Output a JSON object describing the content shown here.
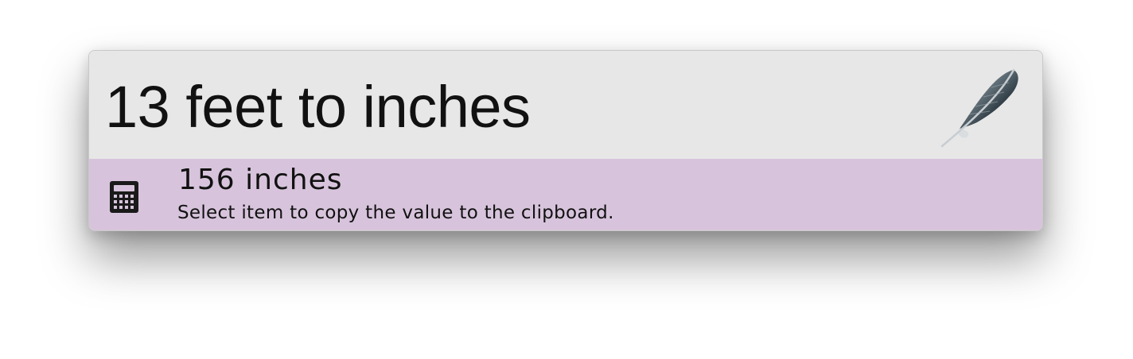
{
  "search": {
    "query": "13 feet to inches",
    "app_icon": "feather-icon"
  },
  "result": {
    "icon": "calculator-icon",
    "title": "156 inches",
    "subtitle": "Select item to copy the value to the clipboard.",
    "highlight_color": "#d7c4dc"
  }
}
